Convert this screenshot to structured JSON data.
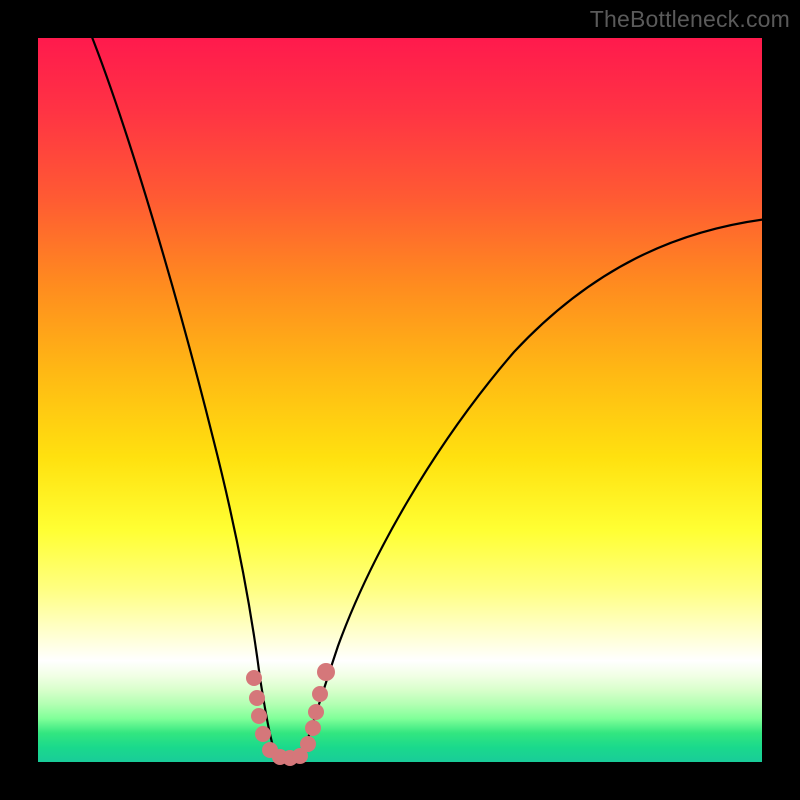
{
  "watermark": "TheBottleneck.com",
  "colors": {
    "frame": "#000000",
    "curve": "#000000",
    "markers": "#d5777a",
    "gradient_top": "#ff1a4d",
    "gradient_bottom": "#19cc99"
  },
  "chart_data": {
    "type": "line",
    "title": "",
    "xlabel": "",
    "ylabel": "",
    "xlim": [
      0,
      100
    ],
    "ylim": [
      0,
      100
    ],
    "series": [
      {
        "name": "bottleneck-left",
        "x": [
          6,
          12,
          18,
          22,
          25,
          28,
          30,
          31.5,
          32.5
        ],
        "values": [
          100,
          83,
          62,
          45,
          32,
          20,
          11,
          4,
          1
        ]
      },
      {
        "name": "bottleneck-right",
        "x": [
          36,
          38,
          41,
          45,
          50,
          56,
          63,
          72,
          82,
          92,
          100
        ],
        "values": [
          1,
          4,
          8,
          14,
          22,
          31,
          41,
          52,
          62,
          70,
          75
        ]
      }
    ],
    "markers": {
      "name": "highlighted-points",
      "x": [
        29.5,
        30.2,
        32.0,
        33.5,
        34.5,
        35.5,
        37.0,
        37.8,
        38.2,
        38.5
      ],
      "values": [
        11.5,
        6.0,
        1.5,
        0.8,
        0.8,
        0.8,
        2.5,
        6.5,
        10.0,
        12.5
      ]
    }
  }
}
